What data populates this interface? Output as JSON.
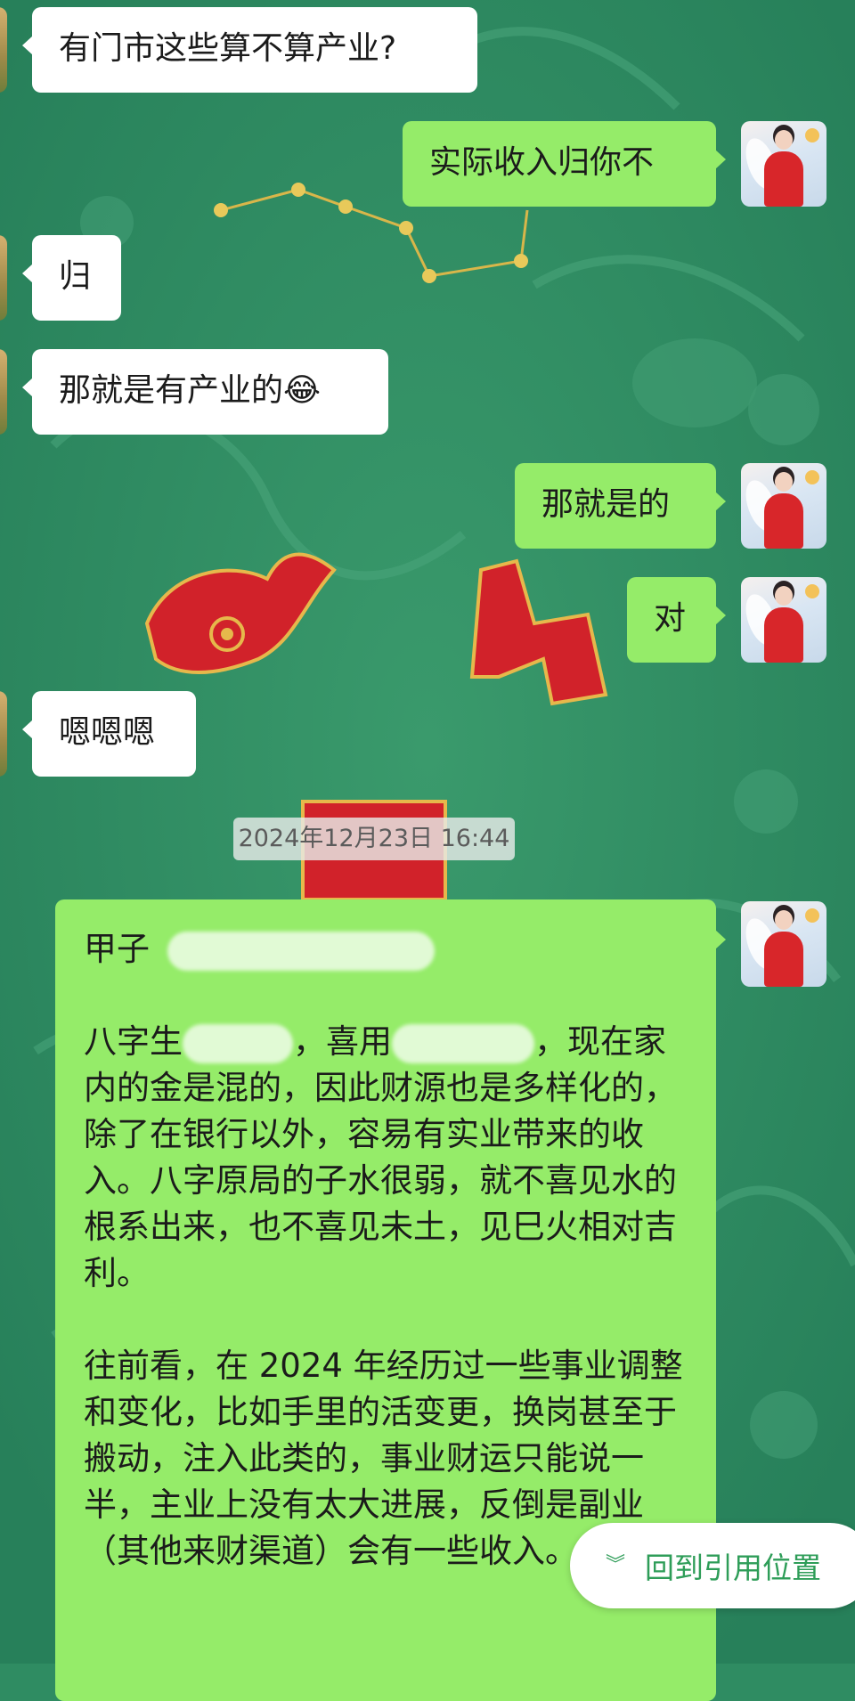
{
  "messages": [
    {
      "side": "left",
      "text": "有门市这些算不算产业?"
    },
    {
      "side": "right",
      "text": "实际收入归你不"
    },
    {
      "side": "left",
      "text": "归"
    },
    {
      "side": "left",
      "text": "那就是有产业的😂"
    },
    {
      "side": "right",
      "text": "那就是的"
    },
    {
      "side": "right",
      "text": "对"
    },
    {
      "side": "left",
      "text": "嗯嗯嗯"
    }
  ],
  "timestamp": "2024年12月23日 16:44",
  "long_message": {
    "line1": "甲子",
    "p1_a": "八字生",
    "p1_b": "，喜用",
    "p1_c": "，现在家内的金是混的，因此财源也是多样化的，除了在银行以外，容易有实业带来的收入。八字原局的子水很弱，就不喜见水的根系出来，也不喜见未土，见巳火相对吉利。",
    "p2": "往前看，在 2024 年经历过一些事业调整和变化，比如手里的活变更，换岗甚至于搬动，注入此类的，事业财运只能说一半，主业上没有太大进展，反倒是副业（其他来财渠道）会有一些收入。"
  },
  "jump_button": {
    "label": "回到引用位置",
    "icon": "double-chevron-down-icon"
  },
  "colors": {
    "background": "#2f8c62",
    "bubble_self": "#95ec69",
    "bubble_other": "#ffffff",
    "jump_text": "#2e9d58"
  }
}
